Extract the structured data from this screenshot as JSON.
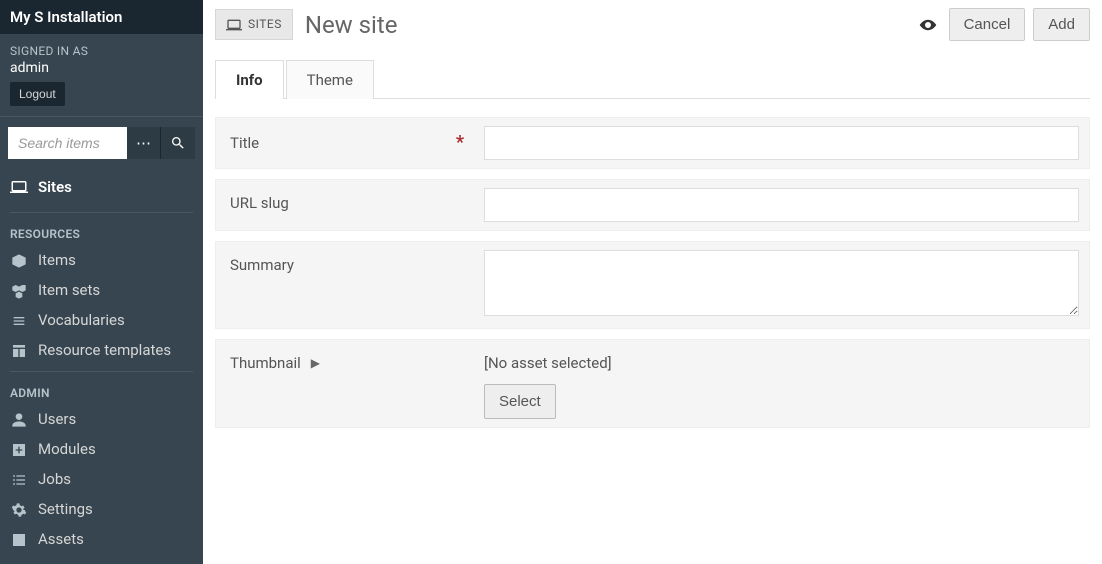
{
  "sidebar": {
    "site_title": "My S Installation",
    "signed_in_label": "SIGNED IN AS",
    "user": "admin",
    "logout": "Logout",
    "search_placeholder": "Search items",
    "sites_label": "Sites",
    "resources_heading": "RESOURCES",
    "resources": [
      {
        "label": "Items"
      },
      {
        "label": "Item sets"
      },
      {
        "label": "Vocabularies"
      },
      {
        "label": "Resource templates"
      }
    ],
    "admin_heading": "ADMIN",
    "admin": [
      {
        "label": "Users"
      },
      {
        "label": "Modules"
      },
      {
        "label": "Jobs"
      },
      {
        "label": "Settings"
      },
      {
        "label": "Assets"
      }
    ]
  },
  "header": {
    "crumb": "SITES",
    "title": "New site",
    "cancel": "Cancel",
    "add": "Add"
  },
  "tabs": {
    "info": "Info",
    "theme": "Theme"
  },
  "form": {
    "title_label": "Title",
    "title_value": "",
    "slug_label": "URL slug",
    "slug_value": "",
    "summary_label": "Summary",
    "summary_value": "",
    "thumbnail_label": "Thumbnail",
    "thumbnail_status": "[No asset selected]",
    "select": "Select"
  }
}
